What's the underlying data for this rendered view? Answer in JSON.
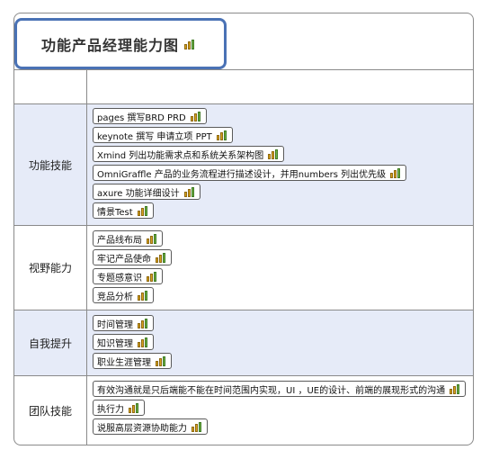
{
  "title": "功能产品经理能力图",
  "categories": [
    {
      "label": "功能技能",
      "items": [
        "pages 撰写BRD PRD",
        "keynote 撰写 申请立项 PPT",
        "Xmind 列出功能需求点和系统关系架构图",
        "OmniGraffle 产品的业务流程进行描述设计，并用numbers 列出优先级",
        "axure 功能详细设计",
        "情景Test"
      ]
    },
    {
      "label": "视野能力",
      "items": [
        "产品线布局",
        "牢记产品使命",
        "专题感意识",
        "竞品分析"
      ]
    },
    {
      "label": "自我提升",
      "items": [
        "时间管理",
        "知识管理",
        "职业生涯管理"
      ]
    },
    {
      "label": "团队技能",
      "items": [
        "有效沟通就是只后端能不能在时间范围内实现，UI ，UE的设计、前端的展现形式的沟通",
        "执行力",
        "说服高层资源协助能力"
      ]
    }
  ],
  "icons": {
    "topic_marker": "bar-chart-icon"
  },
  "colors": {
    "title_border": "#4a72b5",
    "shaded_row": "#e6ebf8",
    "grid_line": "#8a8a8a"
  }
}
